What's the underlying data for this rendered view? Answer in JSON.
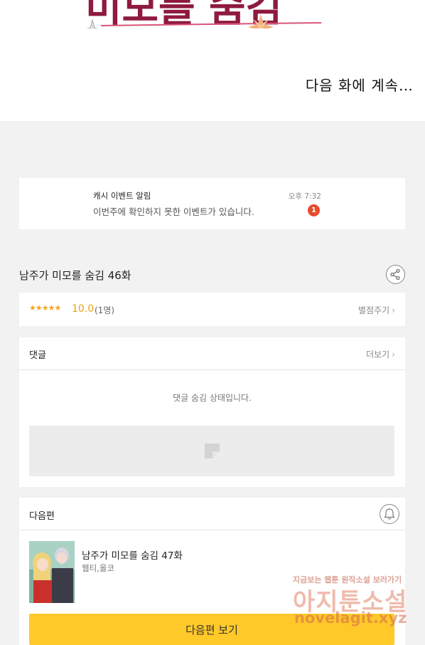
{
  "comic": {
    "next_text": "다음 화에 계속…"
  },
  "notification": {
    "title": "캐시 이벤트 알림",
    "message": "이번주에 확인하지 못한 이벤트가 있습니다.",
    "time": "오후 7:32",
    "badge": "1"
  },
  "episode": {
    "title": "남주가 미모를 숨김 46화"
  },
  "rating": {
    "stars": "★★★★★",
    "score": "10.0",
    "count": "(1명)",
    "action": "별점주기"
  },
  "comments": {
    "title": "댓글",
    "more": "더보기",
    "hidden_message": "댓글 숨김 상태입니다."
  },
  "next_episode": {
    "section_title": "다음편",
    "title": "남주가 미모를 숨김 47화",
    "author": "웹티,올코",
    "button": "다음편 보기"
  },
  "watermark": {
    "tagline": "지금보는 웹툰 원작소설 보러가기",
    "name": "아지툰소설",
    "url": "novelagit.xyz"
  },
  "colors": {
    "accent_yellow": "#ffc929",
    "badge_red": "#e74c2c",
    "star": "#f5a623"
  }
}
